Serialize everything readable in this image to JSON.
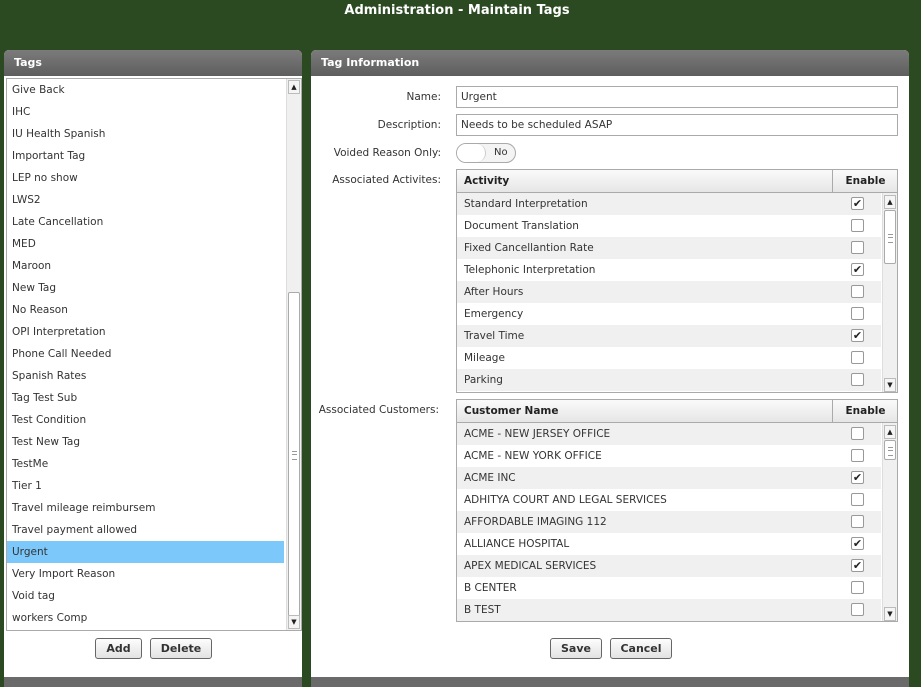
{
  "page": {
    "title": "Administration - Maintain Tags"
  },
  "tags_panel": {
    "header": "Tags",
    "items": [
      "Give Back",
      "IHC",
      "IU Health Spanish",
      "Important Tag",
      "LEP no show",
      "LWS2",
      "Late Cancellation",
      "MED",
      "Maroon",
      "New Tag",
      "No Reason",
      "OPI Interpretation",
      "Phone Call Needed",
      "Spanish Rates",
      "Tag Test Sub",
      "Test Condition",
      "Test New Tag",
      "TestMe",
      "Tier 1",
      "Travel mileage reimbursem",
      "Travel payment allowed",
      "Urgent",
      "Very Import Reason",
      "Void tag",
      "workers Comp"
    ],
    "selected": "Urgent",
    "add_label": "Add",
    "delete_label": "Delete"
  },
  "info_panel": {
    "header": "Tag Information",
    "name_label": "Name:",
    "name_value": "Urgent",
    "description_label": "Description:",
    "description_value": "Needs to be scheduled ASAP",
    "voided_label": "Voided Reason Only:",
    "voided_value": "No",
    "activities_label": "Associated Activites:",
    "activities": {
      "col_name": "Activity",
      "col_enable": "Enable",
      "rows": [
        {
          "name": "Standard Interpretation",
          "checked": true
        },
        {
          "name": "Document Translation",
          "checked": false
        },
        {
          "name": "Fixed Cancellantion Rate",
          "checked": false
        },
        {
          "name": "Telephonic Interpretation",
          "checked": true
        },
        {
          "name": "After Hours",
          "checked": false
        },
        {
          "name": "Emergency",
          "checked": false
        },
        {
          "name": "Travel Time",
          "checked": true
        },
        {
          "name": "Mileage",
          "checked": false
        },
        {
          "name": "Parking",
          "checked": false
        }
      ]
    },
    "customers_label": "Associated Customers:",
    "customers": {
      "col_name": "Customer Name",
      "col_enable": "Enable",
      "rows": [
        {
          "name": "ACME - NEW JERSEY OFFICE",
          "checked": false
        },
        {
          "name": "ACME - NEW YORK OFFICE",
          "checked": false
        },
        {
          "name": "ACME INC",
          "checked": true
        },
        {
          "name": "ADHITYA COURT AND LEGAL SERVICES",
          "checked": false
        },
        {
          "name": "AFFORDABLE IMAGING 112",
          "checked": false
        },
        {
          "name": "ALLIANCE HOSPITAL",
          "checked": true
        },
        {
          "name": "APEX MEDICAL SERVICES",
          "checked": true
        },
        {
          "name": "B CENTER",
          "checked": false
        },
        {
          "name": "B TEST",
          "checked": false
        }
      ]
    },
    "save_label": "Save",
    "cancel_label": "Cancel"
  },
  "icons": {
    "scroll_up": "arrow-up-icon",
    "scroll_down": "arrow-down-icon",
    "check": "checkmark-icon"
  }
}
